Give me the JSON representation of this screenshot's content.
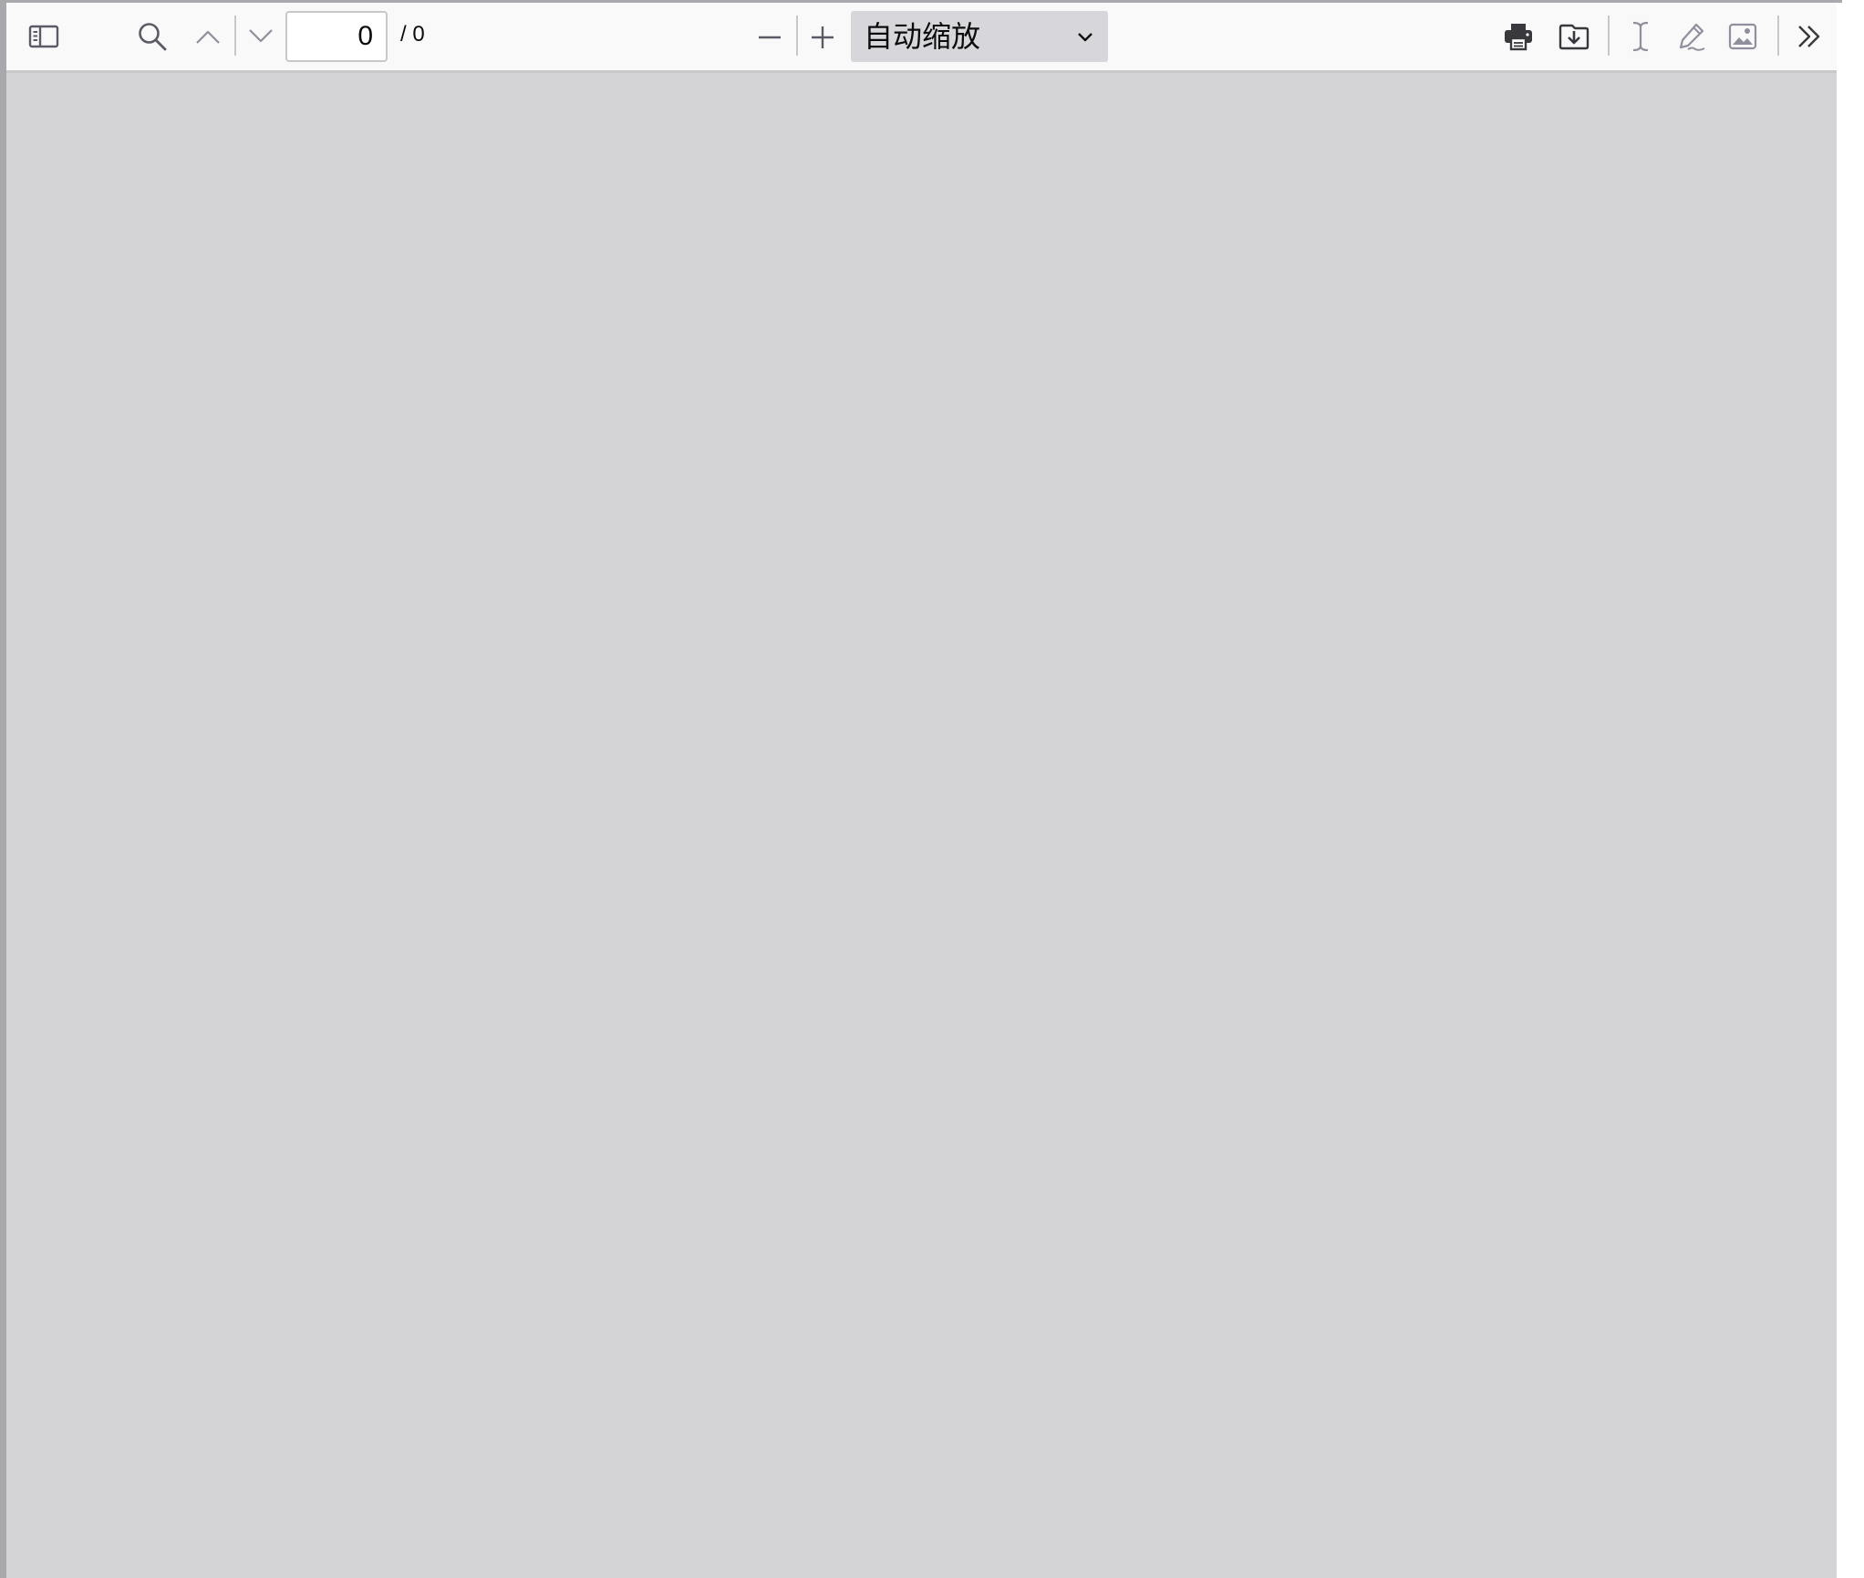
{
  "toolbar": {
    "icons": {
      "sidebar": "sidebar-toggle-icon",
      "find": "search-icon",
      "previous": "chevron-up-icon",
      "next": "chevron-down-icon",
      "zoom_out": "minus-icon",
      "zoom_in": "plus-icon",
      "print": "printer-icon",
      "download": "download-icon",
      "text_tool": "text-cursor-icon",
      "draw_tool": "pencil-icon",
      "image_tool": "image-icon",
      "more": "double-chevron-right-icon"
    },
    "page_number": "0",
    "page_total": "/ 0",
    "zoom": {
      "selected": "自动缩放"
    }
  },
  "colors": {
    "toolbar_bg": "#f9f9fa",
    "canvas_bg": "#d4d4d7",
    "icon": "#5b5b66",
    "zoom_select_bg": "#d7d7db"
  }
}
